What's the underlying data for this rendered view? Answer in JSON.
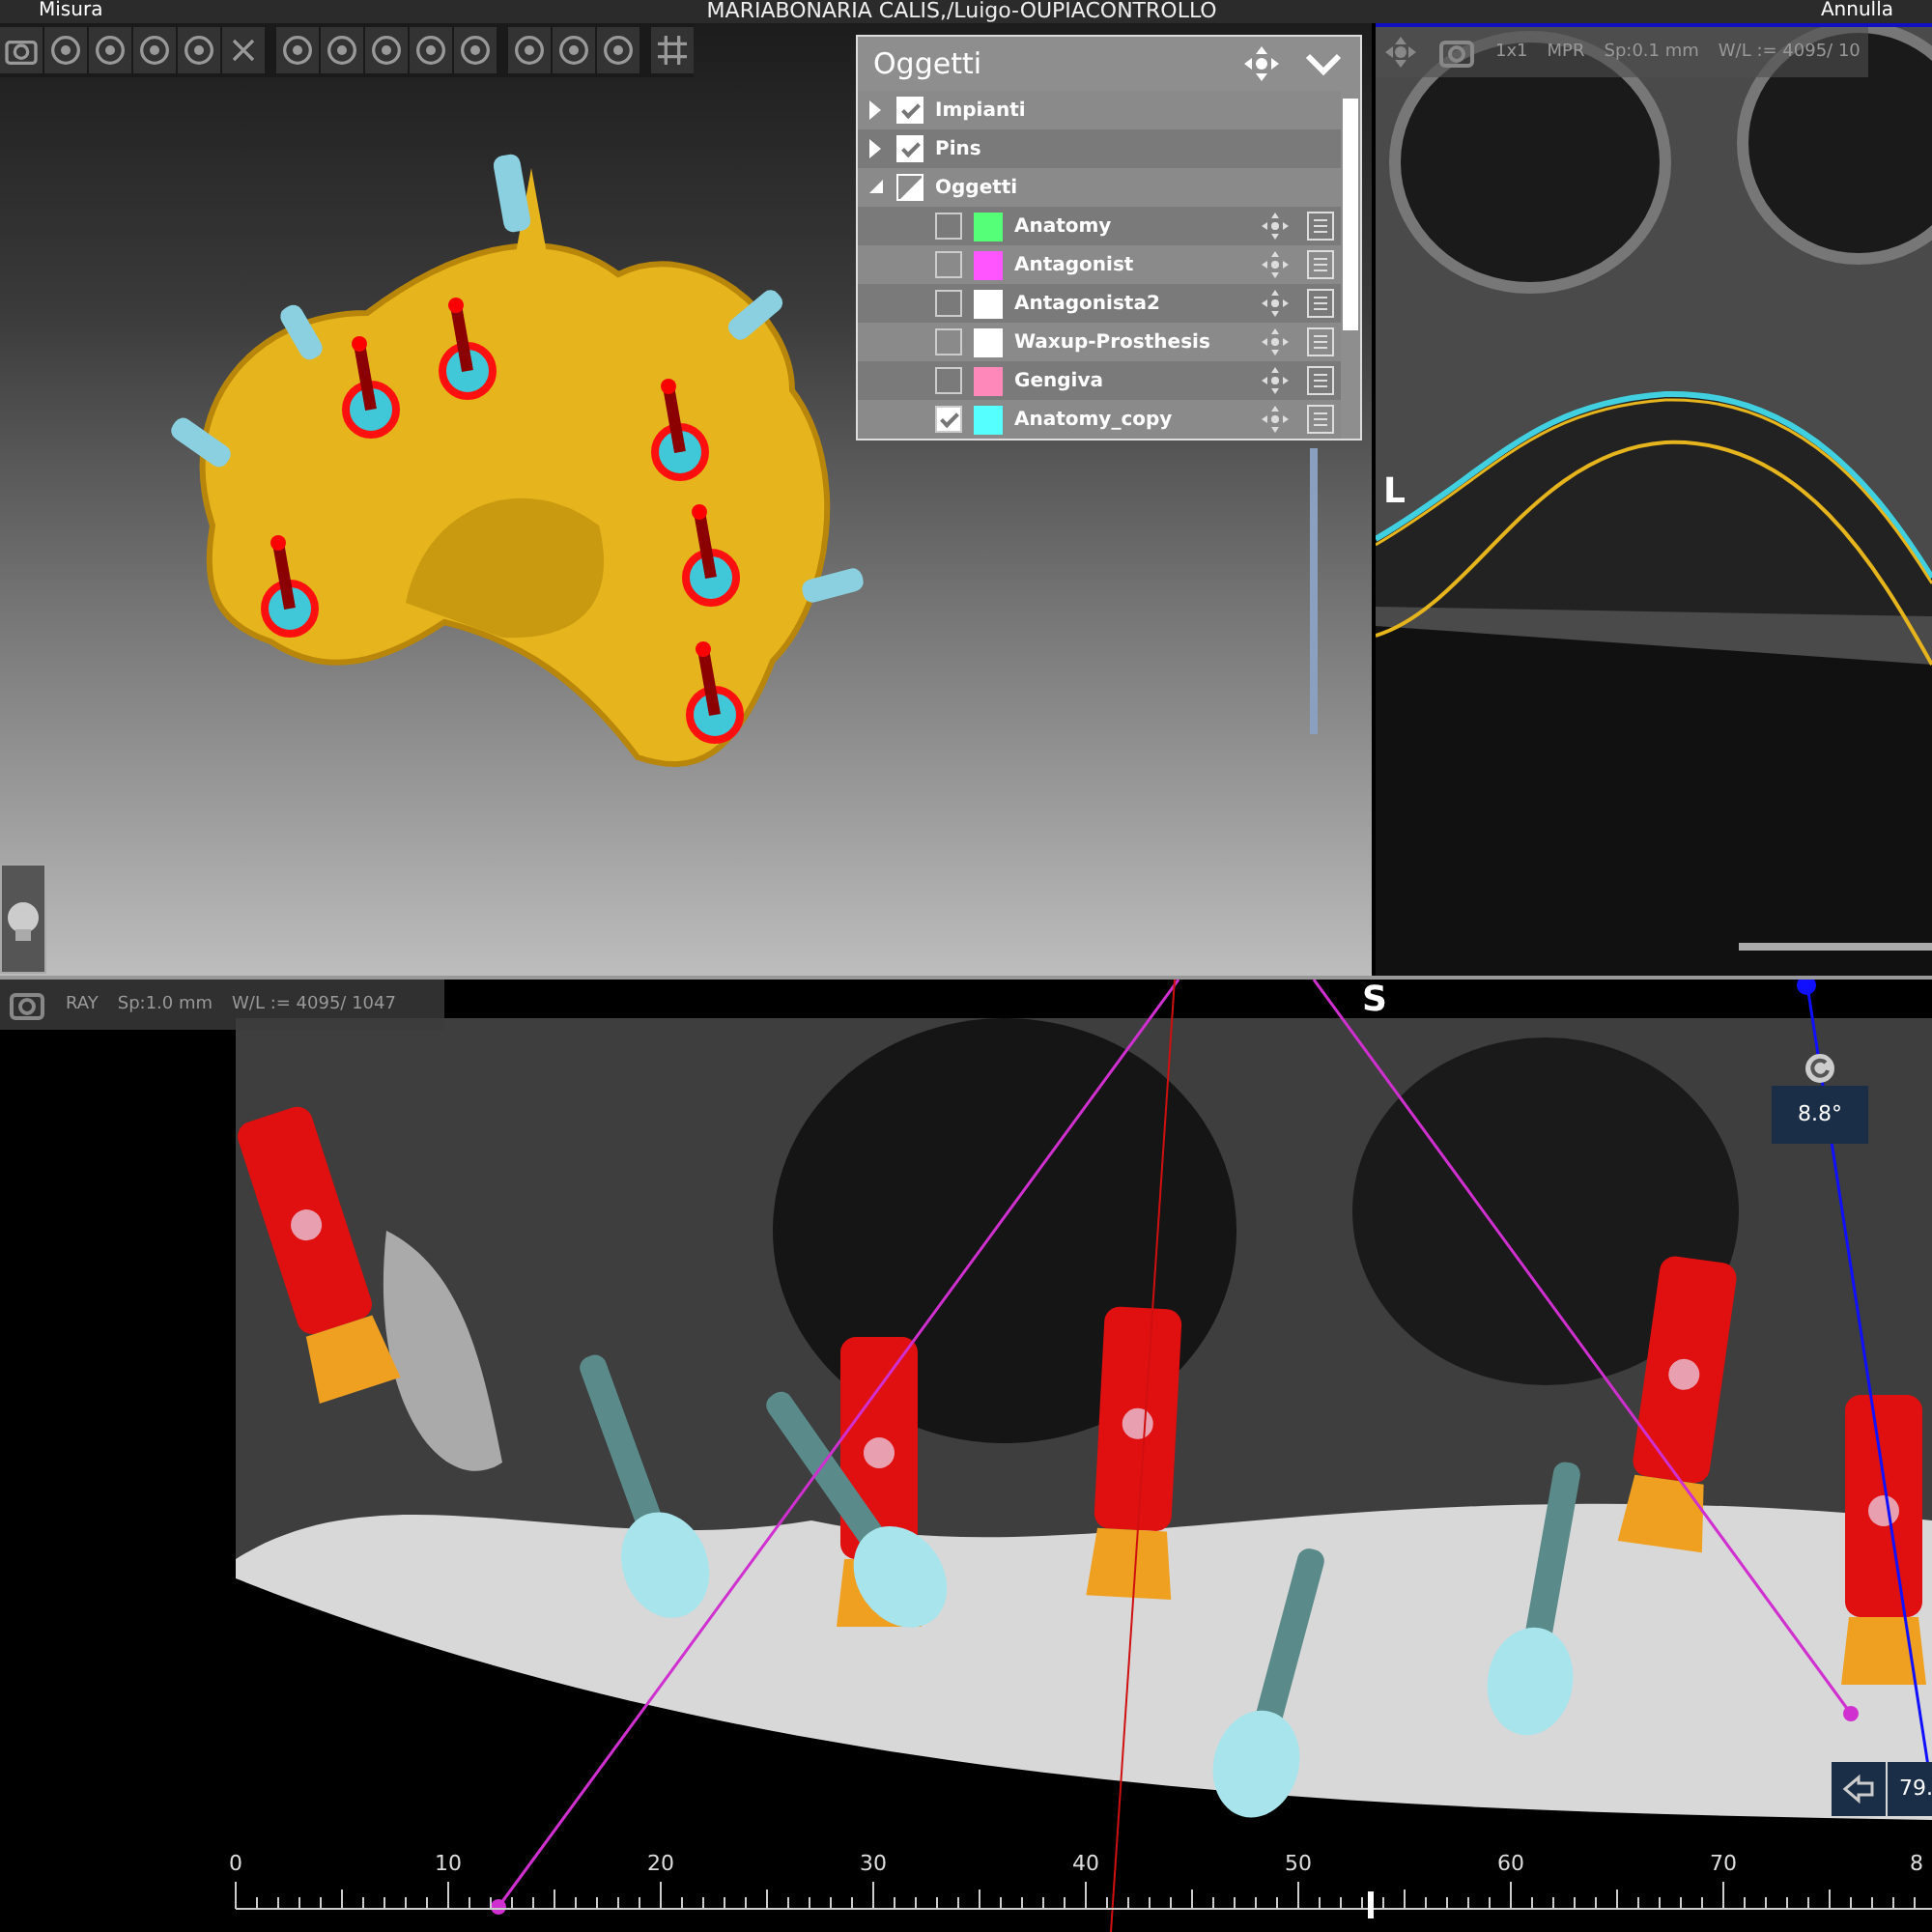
{
  "top_bar": {
    "left_label": "Misura",
    "title": "MARIABONARIA CALIS,/Luigo-OUPIACONTROLLO",
    "right_label": "Annulla"
  },
  "objects_panel": {
    "title": "Oggetti",
    "items": [
      {
        "label": "Impianti",
        "expanded": false,
        "checked": true
      },
      {
        "label": "Pins",
        "expanded": false,
        "checked": true
      },
      {
        "label": "Oggetti",
        "expanded": true,
        "partial": true,
        "children": [
          {
            "label": "Anatomy",
            "color": "#55ff77",
            "checked": false
          },
          {
            "label": "Antagonist",
            "color": "#ff55ff",
            "checked": false
          },
          {
            "label": "Antagonista2",
            "color": "#ffffff",
            "checked": false
          },
          {
            "label": "Waxup-Prosthesis",
            "color": "#ffffff",
            "checked": false
          },
          {
            "label": "Gengiva",
            "color": "#ff88bb",
            "checked": false
          },
          {
            "label": "Anatomy_copy",
            "color": "#55ffff",
            "checked": true
          }
        ]
      }
    ]
  },
  "mpr_view": {
    "labels": [
      "1x1",
      "MPR",
      "Sp:0.1 mm",
      "W/L := 4095/ 10"
    ],
    "orientation_label": "L"
  },
  "panoramic_view": {
    "labels": [
      "RAY",
      "Sp:1.0 mm",
      "W/L := 4095/ 1047"
    ],
    "orientation_label": "S",
    "angle": "8.8°",
    "measurement": "79.",
    "ruler_labels": [
      "0",
      "10",
      "20",
      "30",
      "40",
      "50",
      "60",
      "70",
      "8"
    ]
  }
}
